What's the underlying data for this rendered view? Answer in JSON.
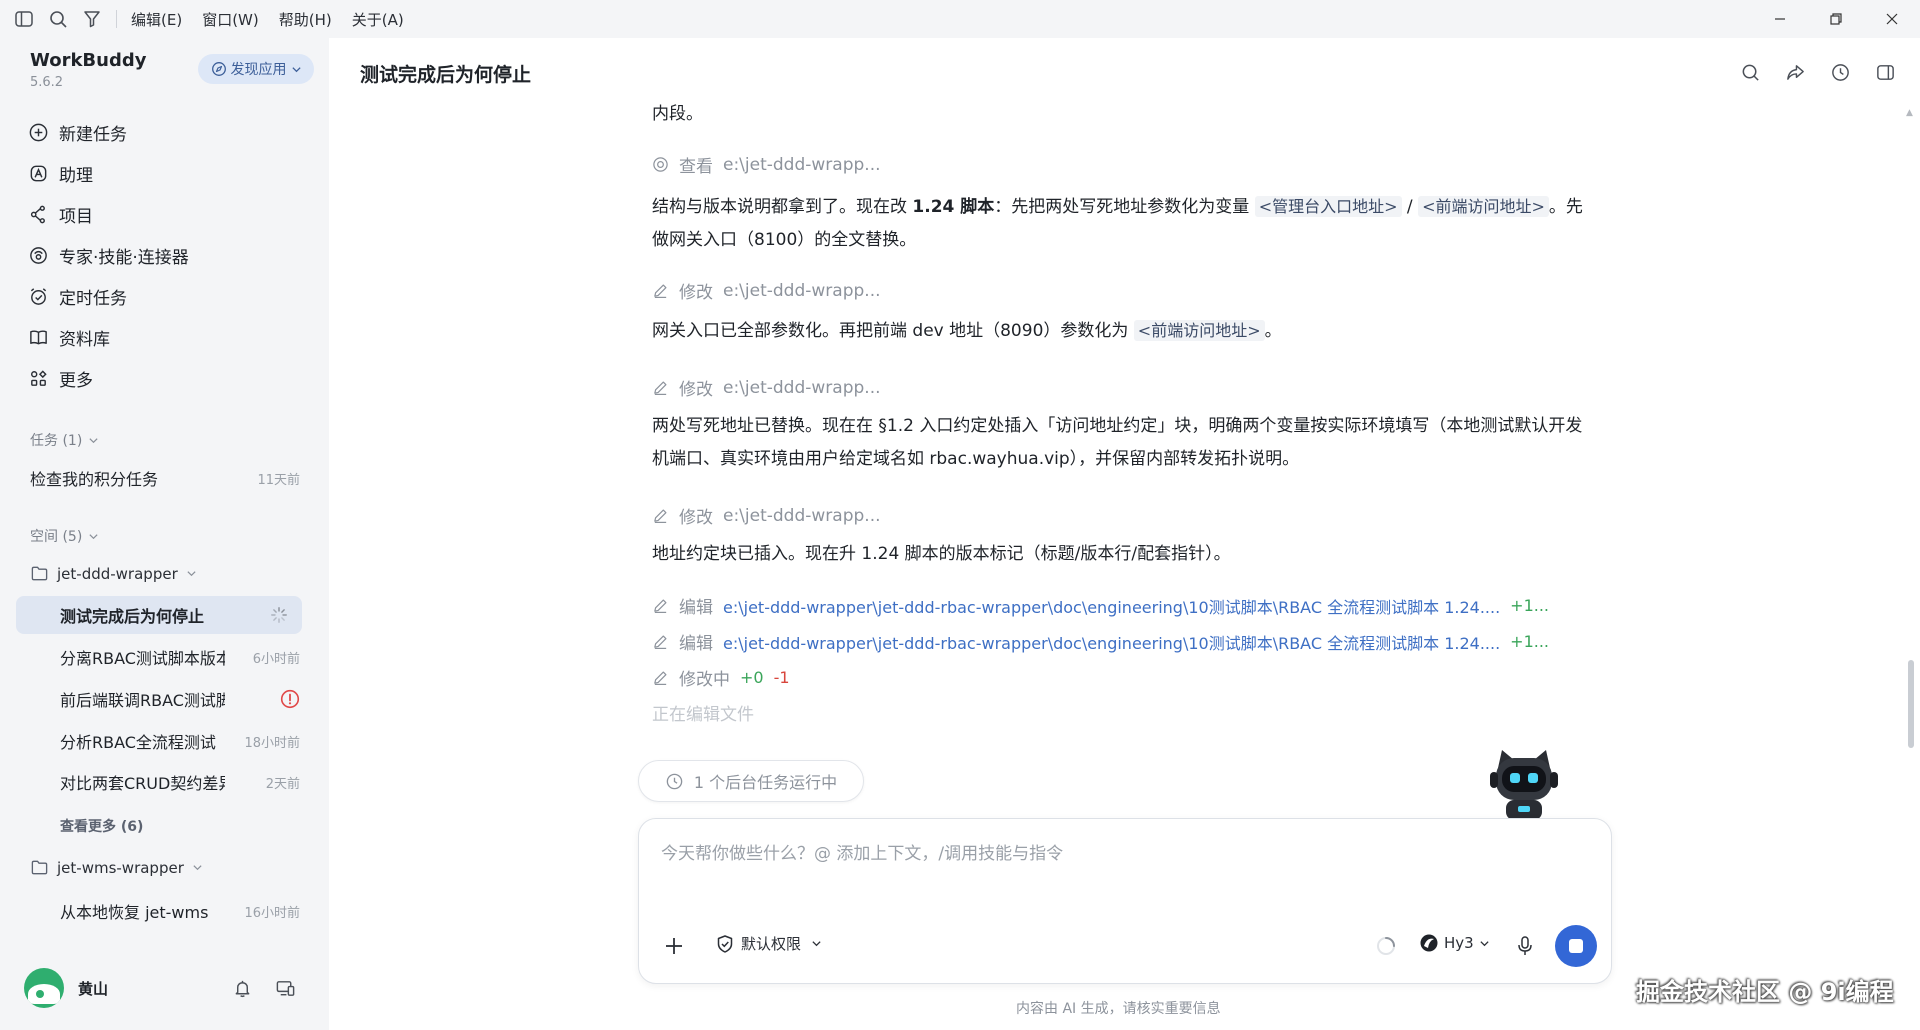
{
  "menubar": {
    "items": [
      "编辑(E)",
      "窗口(W)",
      "帮助(H)",
      "关于(A)"
    ]
  },
  "sidebar": {
    "app_name": "WorkBuddy",
    "version": "5.6.2",
    "discover_label": "发现应用",
    "nav": [
      "新建任务",
      "助理",
      "项目",
      "专家·技能·连接器",
      "定时任务",
      "资料库",
      "更多"
    ],
    "tasks_header": "任务 (1)",
    "tasks": [
      {
        "title": "检查我的积分任务",
        "time": "11天前"
      }
    ],
    "spaces_header": "空间 (5)",
    "workspaces": [
      {
        "name": "jet-ddd-wrapper",
        "items": [
          {
            "title": "测试完成后为何停止",
            "time": ""
          },
          {
            "title": "分离RBAC测试脚本版本",
            "time": "6小时前"
          },
          {
            "title": "前后端联调RBAC测试脚本",
            "time": ""
          },
          {
            "title": "分析RBAC全流程测试",
            "time": "18小时前"
          },
          {
            "title": "对比两套CRUD契约差异",
            "time": "2天前"
          }
        ],
        "more": "查看更多 (6)"
      },
      {
        "name": "jet-wms-wrapper",
        "items": [
          {
            "title": "从本地恢复 jet-wms",
            "time": "16小时前"
          }
        ]
      }
    ],
    "user": {
      "name": "黄山"
    }
  },
  "main": {
    "title": "测试完成后为何停止",
    "messages": {
      "m0": "内段。",
      "a1_verb": "查看",
      "a1_path": "e:\\jet-ddd-wrapp...",
      "m1_pre": "结构与版本说明都拿到了。现在改 ",
      "m1_bold": "1.24 脚本",
      "m1_mid": "：先把两处写死地址参数化为变量 ",
      "m1_code1": "<管理台入口地址>",
      "m1_slash": " / ",
      "m1_code2": "<前端访问地址>",
      "m1_post": "。先做网关入口（8100）的全文替换。",
      "a2_verb": "修改",
      "a2_path": "e:\\jet-ddd-wrapp...",
      "m2_pre": "网关入口已全部参数化。再把前端 dev 地址（8090）参数化为 ",
      "m2_code": "<前端访问地址>",
      "m2_post": "。",
      "a3_verb": "修改",
      "a3_path": "e:\\jet-ddd-wrapp...",
      "m3": "两处写死地址已替换。现在在 §1.2 入口约定处插入「访问地址约定」块，明确两个变量按实际环境填写（本地测试默认开发机端口、真实环境由用户给定域名如 rbac.wayhua.vip），并保留内部转发拓扑说明。",
      "a4_verb": "修改",
      "a4_path": "e:\\jet-ddd-wrapp...",
      "m4": "地址约定块已插入。现在升 1.24 脚本的版本标记（标题/版本行/配套指针）。",
      "a5_verb": "编辑",
      "a5_path": "e:\\jet-ddd-wrapper\\jet-ddd-rbac-wrapper\\doc\\engineering\\10测试脚本\\RBAC 全流程测试脚本 1.24....",
      "a5_plus": "+1...",
      "a6_verb": "编辑",
      "a6_path": "e:\\jet-ddd-wrapper\\jet-ddd-rbac-wrapper\\doc\\engineering\\10测试脚本\\RBAC 全流程测试脚本 1.24....",
      "a6_plus": "+1...",
      "a7_verb": "修改中",
      "a7_plus": "+0",
      "a7_minus": "-1",
      "editing": "正在编辑文件"
    },
    "background_task": "1 个后台任务运行中",
    "composer": {
      "placeholder": "今天帮你做些什么？@ 添加上下文，/调用技能与指令",
      "permission": "默认权限",
      "model": "Hy3"
    },
    "disclaimer": "内容由 AI 生成，请核实重要信息"
  },
  "watermark": "掘金技术社区 @ 9i编程",
  "colors": {
    "accent": "#3367d6",
    "link": "#3e6fc4",
    "added": "#3aa55a",
    "removed": "#d8453c",
    "warning": "#e04848"
  }
}
